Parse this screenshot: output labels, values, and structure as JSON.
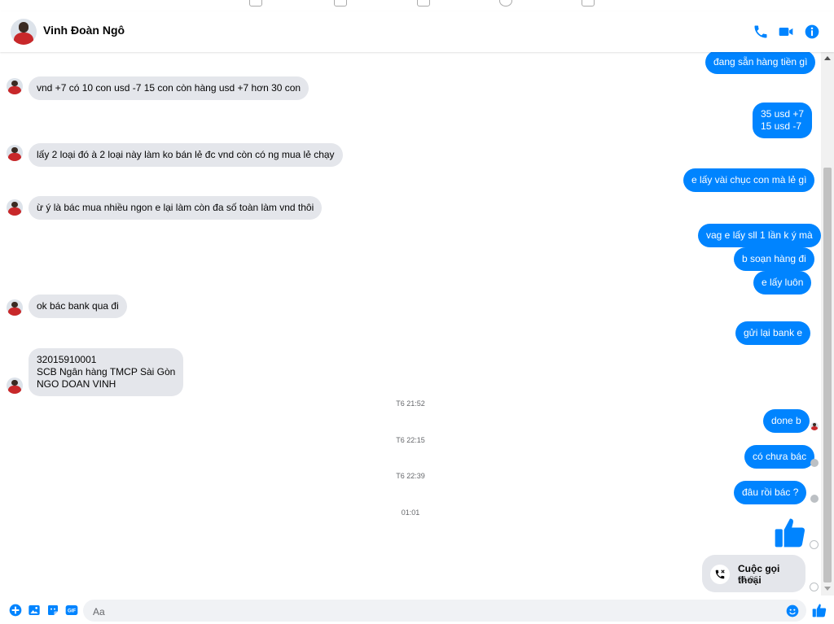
{
  "header": {
    "contact_name": "Vinh Đoàn Ngô"
  },
  "colors": {
    "accent": "#0084ff",
    "incoming": "#e4e6eb"
  },
  "messages": {
    "m0": "đang sẵn hàng tiền gì",
    "m1": "vnd +7 có 10 con usd -7 15 con còn hàng usd +7 hơn 30 con",
    "m2_line1": "35 usd +7",
    "m2_line2": "15 usd -7",
    "m3": "lấy 2 loại đó à 2 loại này làm ko bán lẻ đc vnd còn có ng mua lẻ chạy",
    "m4": "e lấy vài chục con mà lẻ gì",
    "m5": "ừ ý là bác mua nhiều ngon e lại làm còn đa số toàn làm vnd thôi",
    "m6": "vag e lấy sll 1 lần k ý mà",
    "m7": "b soạn hàng đi",
    "m8": "e lấy luôn",
    "m9": "ok bác bank qua đi",
    "m10": "gửi lại bank e",
    "m11_line1": "32015910001",
    "m11_line2": "SCB  Ngân hàng TMCP Sài Gòn",
    "m11_line3": "NGO DOAN VINH",
    "m12": "done b",
    "m13": "có chưa bác",
    "m14": "đâu rồi bác ?"
  },
  "timestamps": {
    "t1": "T6 21:52",
    "t2": "T6 22:15",
    "t3": "T6 22:39",
    "t4": "01:01"
  },
  "call": {
    "title": "Cuộc gọi thoại",
    "duration": "01:06"
  },
  "composer": {
    "placeholder": "Aa"
  },
  "icons": {
    "header": [
      "phone-icon",
      "video-camera-icon",
      "info-icon"
    ],
    "composer": [
      "plus-icon",
      "image-icon",
      "sticker-icon",
      "gif-icon",
      "emoji-icon",
      "like-icon"
    ]
  }
}
